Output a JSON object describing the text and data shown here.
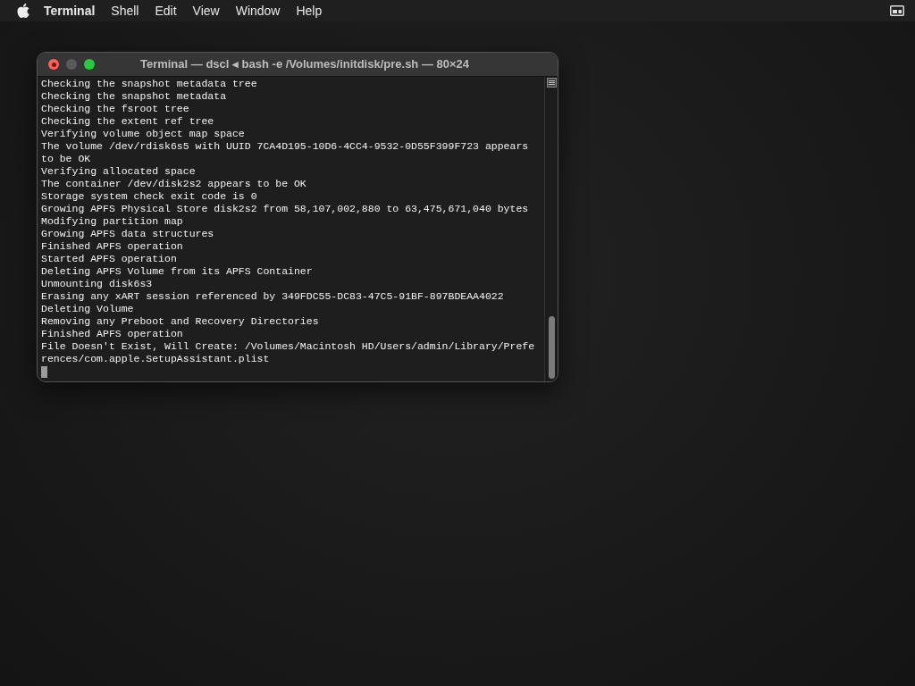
{
  "menu_bar": {
    "items": [
      {
        "label": "Terminal",
        "kind": "app"
      },
      {
        "label": "Shell",
        "kind": "menu"
      },
      {
        "label": "Edit",
        "kind": "menu"
      },
      {
        "label": "View",
        "kind": "menu"
      },
      {
        "label": "Window",
        "kind": "menu"
      },
      {
        "label": "Help",
        "kind": "menu"
      }
    ]
  },
  "window": {
    "title": "Terminal — dscl ◂ bash -e /Volumes/initdisk/pre.sh — 80×24",
    "traffic_lights": [
      {
        "kind": "close",
        "disabled": false
      },
      {
        "kind": "minimize",
        "disabled": true
      },
      {
        "kind": "zoom",
        "disabled": false
      }
    ],
    "lines": [
      "Checking the snapshot metadata tree",
      "Checking the snapshot metadata",
      "Checking the fsroot tree",
      "Checking the extent ref tree",
      "Verifying volume object map space",
      "The volume /dev/rdisk6s5 with UUID 7CA4D195-10D6-4CC4-9532-0D55F399F723 appears",
      "to be OK",
      "Verifying allocated space",
      "The container /dev/disk2s2 appears to be OK",
      "Storage system check exit code is 0",
      "Growing APFS Physical Store disk2s2 from 58,107,002,880 to 63,475,671,040 bytes",
      "Modifying partition map",
      "Growing APFS data structures",
      "Finished APFS operation",
      "Started APFS operation",
      "Deleting APFS Volume from its APFS Container",
      "Unmounting disk6s3",
      "Erasing any xART session referenced by 349FDC55-DC83-47C5-91BF-897BDEAA4022",
      "Deleting Volume",
      "Removing any Preboot and Recovery Directories",
      "Finished APFS operation",
      "File Doesn't Exist, Will Create: /Volumes/Macintosh HD/Users/admin/Library/Prefe",
      "rences/com.apple.SetupAssistant.plist"
    ]
  }
}
